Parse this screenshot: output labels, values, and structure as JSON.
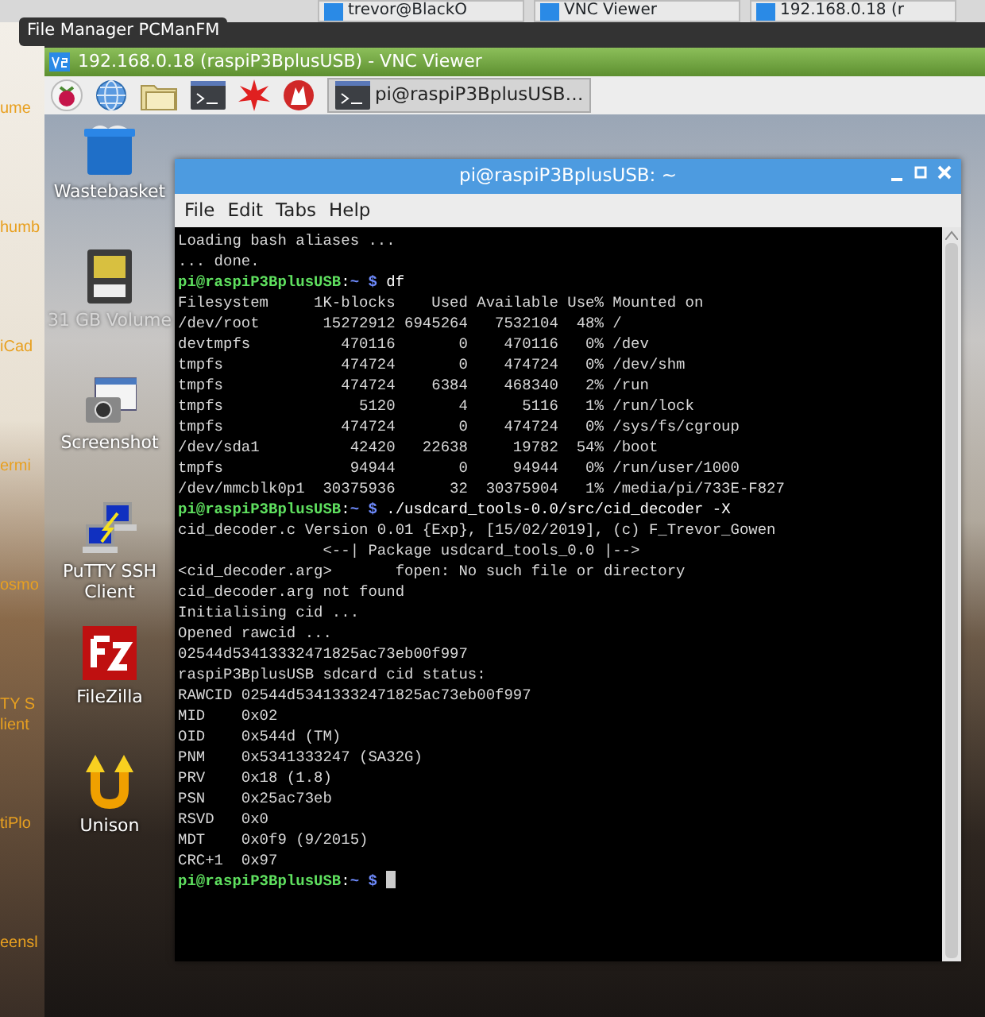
{
  "host_taskbar": {
    "items": [
      {
        "label": "trevor@BlackO"
      },
      {
        "label": "VNC Viewer"
      },
      {
        "label": "192.168.0.18 (r"
      }
    ]
  },
  "tooltip": "File Manager PCManFM",
  "host_desktop_labels": [
    "ume",
    "humb",
    "iCad",
    "ermi",
    "osmo",
    "TY S\nlient",
    "tiPlo",
    "eensl"
  ],
  "vnc_window": {
    "title": "192.168.0.18 (raspiP3BplusUSB) - VNC Viewer"
  },
  "pi_taskbar": {
    "tasks": [
      {
        "label": "pi@raspiP3BplusUSB…",
        "selected": true
      }
    ]
  },
  "desktop_icons": [
    {
      "label": "Wastebasket",
      "kind": "trash"
    },
    {
      "label": "31 GB Volume",
      "kind": "drive"
    },
    {
      "label": "Screenshot",
      "kind": "camera"
    },
    {
      "label": "PuTTY SSH Client",
      "kind": "putty"
    },
    {
      "label": "FileZilla",
      "kind": "filezilla"
    },
    {
      "label": "Unison",
      "kind": "unison"
    }
  ],
  "terminal": {
    "title": "pi@raspiP3BplusUSB: ~",
    "menu": [
      "File",
      "Edit",
      "Tabs",
      "Help"
    ],
    "lines": [
      {
        "kind": "output",
        "text": "Loading bash aliases ..."
      },
      {
        "kind": "output",
        "text": "... done."
      },
      {
        "kind": "prompt",
        "user": "pi@raspiP3BplusUSB",
        "sep": ":",
        "path": "~",
        "symbol": "$",
        "command": "df"
      },
      {
        "kind": "output",
        "text": "Filesystem     1K-blocks    Used Available Use% Mounted on"
      },
      {
        "kind": "output",
        "text": "/dev/root       15272912 6945264   7532104  48% /"
      },
      {
        "kind": "output",
        "text": "devtmpfs          470116       0    470116   0% /dev"
      },
      {
        "kind": "output",
        "text": "tmpfs             474724       0    474724   0% /dev/shm"
      },
      {
        "kind": "output",
        "text": "tmpfs             474724    6384    468340   2% /run"
      },
      {
        "kind": "output",
        "text": "tmpfs               5120       4      5116   1% /run/lock"
      },
      {
        "kind": "output",
        "text": "tmpfs             474724       0    474724   0% /sys/fs/cgroup"
      },
      {
        "kind": "output",
        "text": "/dev/sda1          42420   22638     19782  54% /boot"
      },
      {
        "kind": "output",
        "text": "tmpfs              94944       0     94944   0% /run/user/1000"
      },
      {
        "kind": "output",
        "text": "/dev/mmcblk0p1  30375936      32  30375904   1% /media/pi/733E-F827"
      },
      {
        "kind": "prompt",
        "user": "pi@raspiP3BplusUSB",
        "sep": ":",
        "path": "~",
        "symbol": "$",
        "command": "./usdcard_tools-0.0/src/cid_decoder -X"
      },
      {
        "kind": "output",
        "text": "cid_decoder.c Version 0.01 {Exp}, [15/02/2019], (c) F_Trevor_Gowen"
      },
      {
        "kind": "output",
        "text": "                <--| Package usdcard_tools_0.0 |-->"
      },
      {
        "kind": "output",
        "text": "<cid_decoder.arg>       fopen: No such file or directory"
      },
      {
        "kind": "output",
        "text": "cid_decoder.arg not found"
      },
      {
        "kind": "output",
        "text": "Initialising cid ..."
      },
      {
        "kind": "output",
        "text": "Opened rawcid ..."
      },
      {
        "kind": "output",
        "text": "02544d53413332471825ac73eb00f997"
      },
      {
        "kind": "output",
        "text": "raspiP3BplusUSB sdcard cid status:"
      },
      {
        "kind": "output",
        "text": "RAWCID 02544d53413332471825ac73eb00f997"
      },
      {
        "kind": "output",
        "text": "MID    0x02"
      },
      {
        "kind": "output",
        "text": "OID    0x544d (TM)"
      },
      {
        "kind": "output",
        "text": "PNM    0x5341333247 (SA32G)"
      },
      {
        "kind": "output",
        "text": "PRV    0x18 (1.8)"
      },
      {
        "kind": "output",
        "text": "PSN    0x25ac73eb"
      },
      {
        "kind": "output",
        "text": "RSVD   0x0"
      },
      {
        "kind": "output",
        "text": "MDT    0x0f9 (9/2015)"
      },
      {
        "kind": "output",
        "text": "CRC+1  0x97"
      },
      {
        "kind": "prompt",
        "user": "pi@raspiP3BplusUSB",
        "sep": ":",
        "path": "~",
        "symbol": "$",
        "cursor": true
      }
    ]
  }
}
